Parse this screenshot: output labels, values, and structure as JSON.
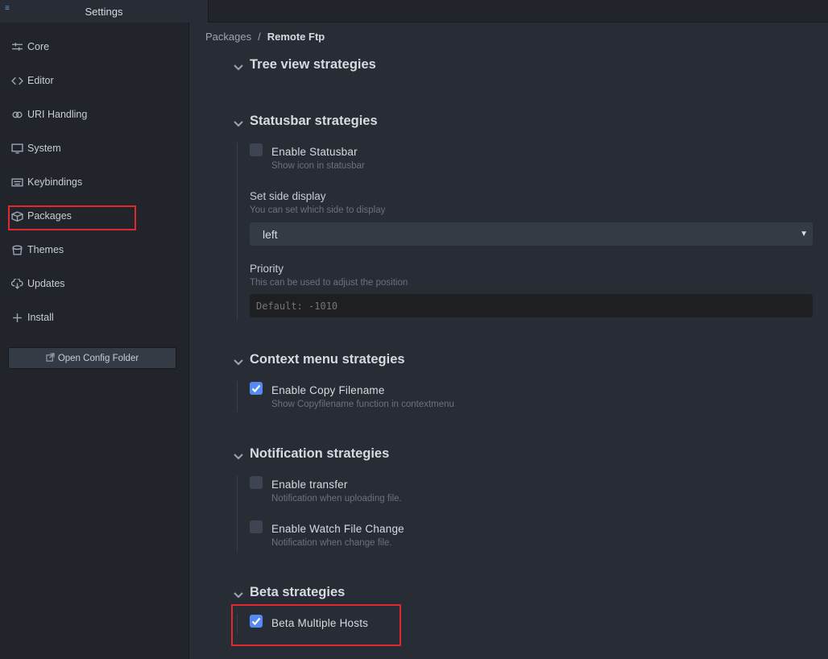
{
  "tab": {
    "title": "Settings"
  },
  "sidebar": {
    "items": [
      {
        "label": "Core",
        "icon": "sliders-icon"
      },
      {
        "label": "Editor",
        "icon": "code-icon"
      },
      {
        "label": "URI Handling",
        "icon": "link-icon"
      },
      {
        "label": "System",
        "icon": "monitor-icon"
      },
      {
        "label": "Keybindings",
        "icon": "keyboard-icon"
      },
      {
        "label": "Packages",
        "icon": "package-icon"
      },
      {
        "label": "Themes",
        "icon": "paintcan-icon"
      },
      {
        "label": "Updates",
        "icon": "cloud-download-icon"
      },
      {
        "label": "Install",
        "icon": "plus-icon"
      }
    ],
    "open_config": "Open Config Folder"
  },
  "breadcrumb": {
    "parent": "Packages",
    "separator": "/",
    "current": "Remote Ftp"
  },
  "sections": {
    "tree": {
      "title": "Tree view strategies"
    },
    "statusbar": {
      "title": "Statusbar strategies",
      "enable_label": "Enable Statusbar",
      "enable_desc": "Show icon in statusbar",
      "enable_checked": false,
      "side_label": "Set side display",
      "side_desc": "You can set which side to display",
      "side_value": "left",
      "priority_label": "Priority",
      "priority_desc": "This can be used to adjust the position",
      "priority_placeholder": "Default: -1010"
    },
    "context": {
      "title": "Context menu strategies",
      "copy_label": "Enable Copy Filename",
      "copy_desc": "Show Copyfilename function in contextmenu",
      "copy_checked": true
    },
    "notification": {
      "title": "Notification strategies",
      "transfer_label": "Enable transfer",
      "transfer_desc": "Notification when uploading file.",
      "transfer_checked": false,
      "watch_label": "Enable Watch File Change",
      "watch_desc": "Notification when change file.",
      "watch_checked": false
    },
    "beta": {
      "title": "Beta strategies",
      "multi_label": "Beta Multiple Hosts",
      "multi_checked": true
    }
  },
  "colors": {
    "accent": "#568af2",
    "highlight": "#e0282e"
  }
}
